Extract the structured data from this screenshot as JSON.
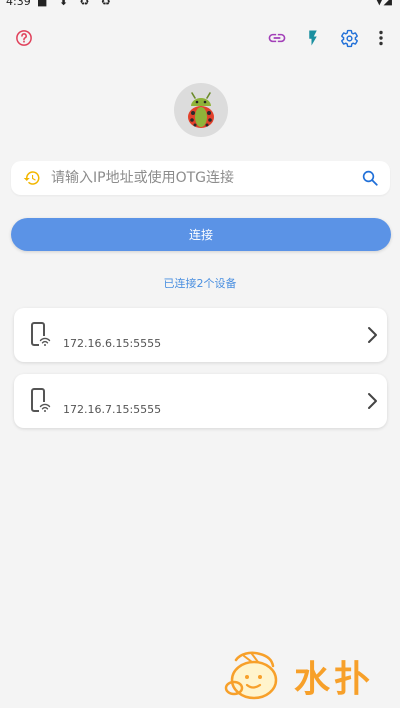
{
  "status_bar": {
    "time": "4:39",
    "left_icons": "■ ⬇ ♻ ♻",
    "right_icons": "▼◢"
  },
  "toolbar": {
    "help_icon": "help-circle-icon",
    "link_icon": "link-icon",
    "flash_icon": "flash-icon",
    "settings_icon": "gear-icon",
    "more_icon": "more-vert-icon"
  },
  "search": {
    "placeholder": "请输入IP地址或使用OTG连接",
    "value": ""
  },
  "connect_button": {
    "label": "连接"
  },
  "connected_count": "已连接2个设备",
  "devices": [
    {
      "address": "172.16.6.15:5555"
    },
    {
      "address": "172.16.7.15:5555"
    }
  ],
  "watermark": {
    "text": "水扑"
  },
  "colors": {
    "primary": "#5b93e6",
    "link_text": "#4a8fe0",
    "help_icon": "#e0405a",
    "link_icon": "#a23fb8",
    "flash_icon": "#1a8fa0",
    "settings_icon": "#1f6fd8",
    "history_icon": "#f2b600",
    "background": "#f4f4f4"
  }
}
